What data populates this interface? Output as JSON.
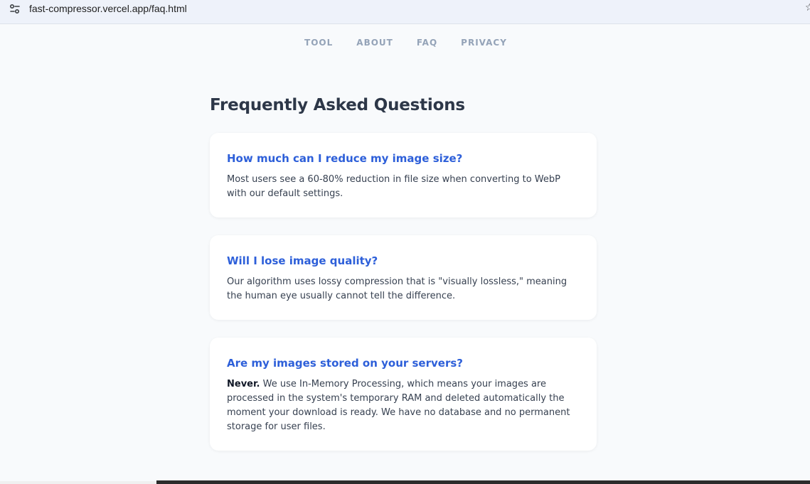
{
  "browser": {
    "url": "fast-compressor.vercel.app/faq.html",
    "site_info_icon": "tune-icon",
    "bookmark_icon": "star-icon"
  },
  "nav": {
    "items": [
      {
        "label": "TOOL"
      },
      {
        "label": "ABOUT"
      },
      {
        "label": "FAQ"
      },
      {
        "label": "PRIVACY"
      }
    ]
  },
  "page": {
    "title": "Frequently Asked Questions"
  },
  "faqs": [
    {
      "question": "How much can I reduce my image size?",
      "answer_lead": "",
      "answer": "Most users see a 60-80% reduction in file size when converting to WebP with our default settings."
    },
    {
      "question": "Will I lose image quality?",
      "answer_lead": "",
      "answer": "Our algorithm uses lossy compression that is \"visually lossless,\" meaning the human eye usually cannot tell the difference."
    },
    {
      "question": "Are my images stored on your servers?",
      "answer_lead": "Never.",
      "answer": " We use In-Memory Processing, which means your images are processed in the system's temporary RAM and deleted automatically the moment your download is ready. We have no database and no permanent storage for user files."
    }
  ],
  "colors": {
    "accent": "#2d5fd9",
    "heading": "#2d3748",
    "nav": "#94a3b8",
    "background": "#f8fafc"
  }
}
